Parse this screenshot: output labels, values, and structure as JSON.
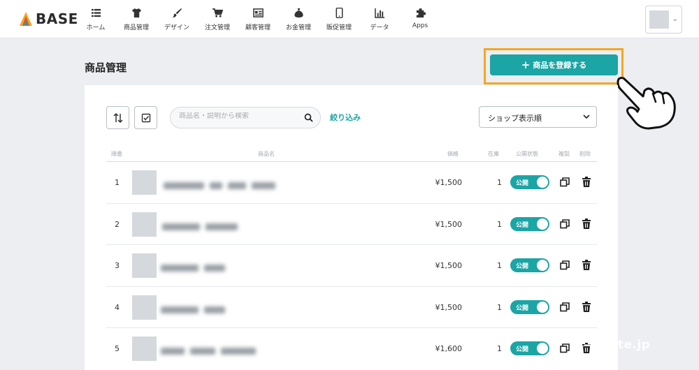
{
  "brand": {
    "name": "BASE"
  },
  "nav": [
    {
      "label": "ホーム",
      "icon": "list-icon"
    },
    {
      "label": "商品管理",
      "icon": "tshirt-icon"
    },
    {
      "label": "デザイン",
      "icon": "brush-icon"
    },
    {
      "label": "注文管理",
      "icon": "cart-icon"
    },
    {
      "label": "顧客管理",
      "icon": "address-card-icon"
    },
    {
      "label": "お金管理",
      "icon": "money-bag-icon"
    },
    {
      "label": "販促管理",
      "icon": "smartphone-icon"
    },
    {
      "label": "データ",
      "icon": "bar-chart-icon"
    },
    {
      "label": "Apps",
      "icon": "puzzle-icon"
    }
  ],
  "page": {
    "title": "商品管理"
  },
  "register_button": {
    "label": "商品を登録する"
  },
  "toolbar": {
    "search_placeholder": "商品名・説明から検索",
    "filter_label": "絞り込み",
    "sort_value": "ショップ表示順"
  },
  "table": {
    "headers": {
      "order": "順番",
      "name": "商品名",
      "price": "価格",
      "stock": "在庫",
      "status": "公開状態",
      "copy": "複製",
      "delete": "削除"
    },
    "rows": [
      {
        "order": "1",
        "price": "¥1,500",
        "stock": "1",
        "status": "公開"
      },
      {
        "order": "2",
        "price": "¥1,500",
        "stock": "1",
        "status": "公開"
      },
      {
        "order": "3",
        "price": "¥1,500",
        "stock": "1",
        "status": "公開"
      },
      {
        "order": "4",
        "price": "¥1,500",
        "stock": "1",
        "status": "公開"
      },
      {
        "order": "5",
        "price": "¥1,600",
        "stock": "1",
        "status": "公開"
      }
    ]
  },
  "watermark": "note.jp",
  "colors": {
    "accent": "#1ba5a5",
    "highlight": "#f5a623",
    "background": "#eceef1"
  }
}
